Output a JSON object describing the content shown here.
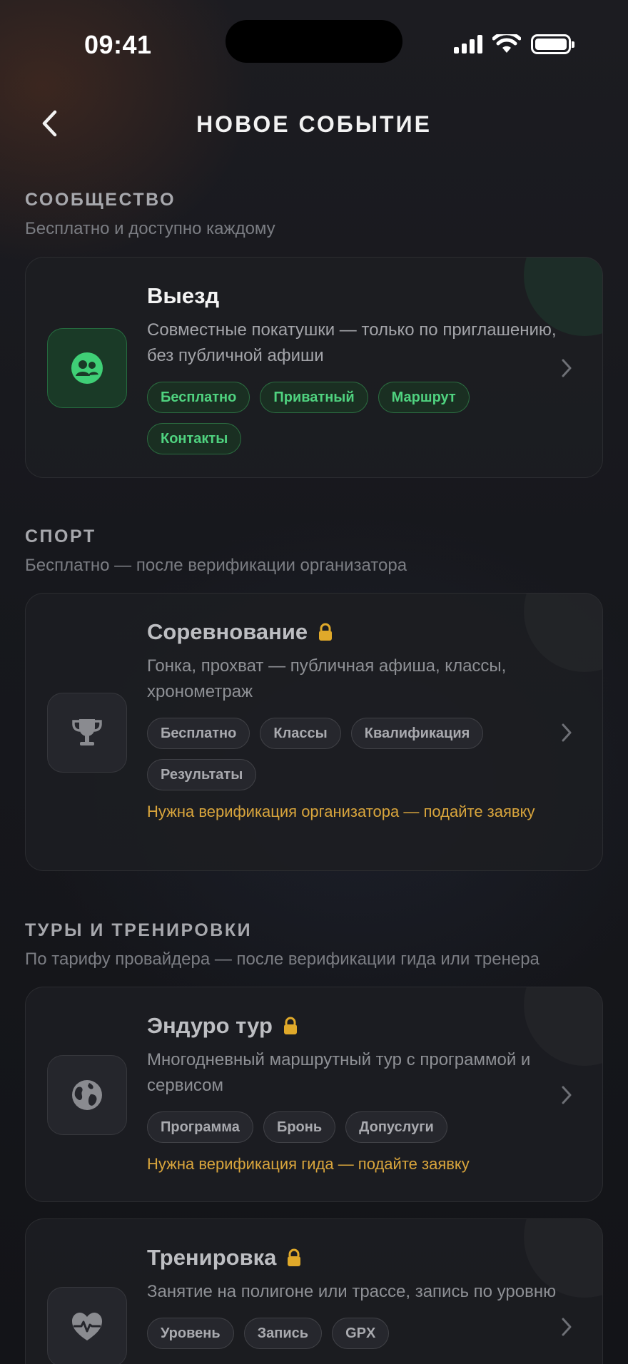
{
  "status_bar": {
    "time": "09:41"
  },
  "header": {
    "title": "НОВОЕ СОБЫТИЕ"
  },
  "sections": [
    {
      "title": "СООБЩЕСТВО",
      "subtitle": "Бесплатно и доступно каждому",
      "cards": [
        {
          "title": "Выезд",
          "description": "Совместные покатушки — только по приглашению, без публичной афиши",
          "tags": [
            "Бесплатно",
            "Приватный",
            "Маршрут",
            "Контакты"
          ],
          "icon": "group-icon",
          "locked": false
        }
      ]
    },
    {
      "title": "СПОРТ",
      "subtitle": "Бесплатно — после верификации организатора",
      "cards": [
        {
          "title": "Соревнование",
          "description": "Гонка, прохват — публичная афиша, классы, хронометраж",
          "tags": [
            "Бесплатно",
            "Классы",
            "Квалификация",
            "Результаты"
          ],
          "warning": "Нужна верификация организатора — подайте заявку",
          "icon": "trophy-icon",
          "locked": true
        }
      ]
    },
    {
      "title": "ТУРЫ И ТРЕНИРОВКИ",
      "subtitle": "По тарифу провайдера — после верификации гида или тренера",
      "cards": [
        {
          "title": "Эндуро тур",
          "description": "Многодневный маршрутный тур с программой и сервисом",
          "tags": [
            "Программа",
            "Бронь",
            "Допуслуги"
          ],
          "warning": "Нужна верификация гида — подайте заявку",
          "icon": "globe-icon",
          "locked": true
        },
        {
          "title": "Тренировка",
          "description": "Занятие на полигоне или трассе, запись по уровню",
          "tags": [
            "Уровень",
            "Запись",
            "GPX"
          ],
          "icon": "heart-pulse-icon",
          "locked": true
        }
      ]
    }
  ],
  "colors": {
    "accent_green": "#4fd27f",
    "warning": "#d9a53c",
    "lock": "#e0a92a",
    "background": "#16171b"
  }
}
